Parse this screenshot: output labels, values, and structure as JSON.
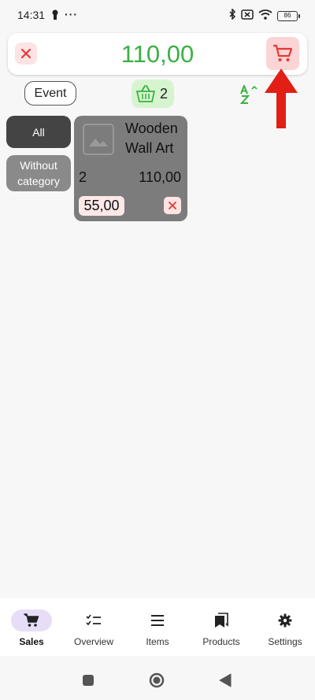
{
  "status": {
    "time": "14:31",
    "dots": "···",
    "battery": "86"
  },
  "cart": {
    "total": "110,00"
  },
  "toolbar": {
    "event_label": "Event",
    "basket_count": "2"
  },
  "categories": [
    {
      "label": "All"
    },
    {
      "label": "Without category"
    }
  ],
  "product": {
    "name": "Wooden Wall Art",
    "quantity": "2",
    "line_total": "110,00",
    "unit_price": "55,00"
  },
  "nav": [
    {
      "label": "Sales",
      "icon": "cart-icon"
    },
    {
      "label": "Overview",
      "icon": "checklist-icon"
    },
    {
      "label": "Items",
      "icon": "list-icon"
    },
    {
      "label": "Products",
      "icon": "bookmarks-icon"
    },
    {
      "label": "Settings",
      "icon": "gear-icon"
    }
  ],
  "colors": {
    "accent_green": "#3cb043",
    "danger_red": "#e53935",
    "nav_active": "#e8ddf6"
  }
}
